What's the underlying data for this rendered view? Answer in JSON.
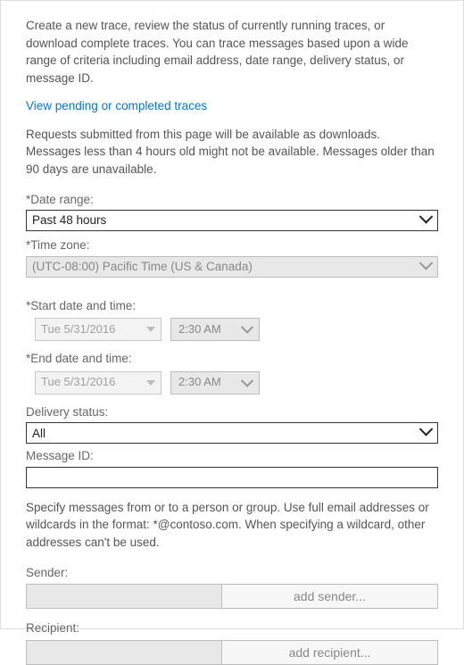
{
  "intro": "Create a new trace, review the status of currently running traces, or download complete traces. You can trace messages based upon a wide range of criteria including email address, date range, delivery status, or message ID.",
  "link": "View pending or completed traces",
  "note": "Requests submitted from this page will be available as downloads. Messages less than 4 hours old might not be available. Messages older than 90 days are unavailable.",
  "dateRange": {
    "label": "*Date range:",
    "value": "Past 48 hours"
  },
  "timeZone": {
    "label": "*Time zone:",
    "value": "(UTC-08:00) Pacific Time (US & Canada)"
  },
  "startDt": {
    "label": "*Start date and time:",
    "date": "Tue 5/31/2016",
    "time": "2:30 AM"
  },
  "endDt": {
    "label": "*End date and time:",
    "date": "Tue 5/31/2016",
    "time": "2:30 AM"
  },
  "deliveryStatus": {
    "label": "Delivery status:",
    "value": "All"
  },
  "messageId": {
    "label": "Message ID:",
    "value": ""
  },
  "personNote": "Specify messages from or to a person or group. Use full email addresses or wildcards in the format: *@contoso.com. When specifying a wildcard, other addresses can't be used.",
  "sender": {
    "label": "Sender:",
    "addLabel": "add sender..."
  },
  "recipient": {
    "label": "Recipient:",
    "addLabel": "add recipient..."
  }
}
